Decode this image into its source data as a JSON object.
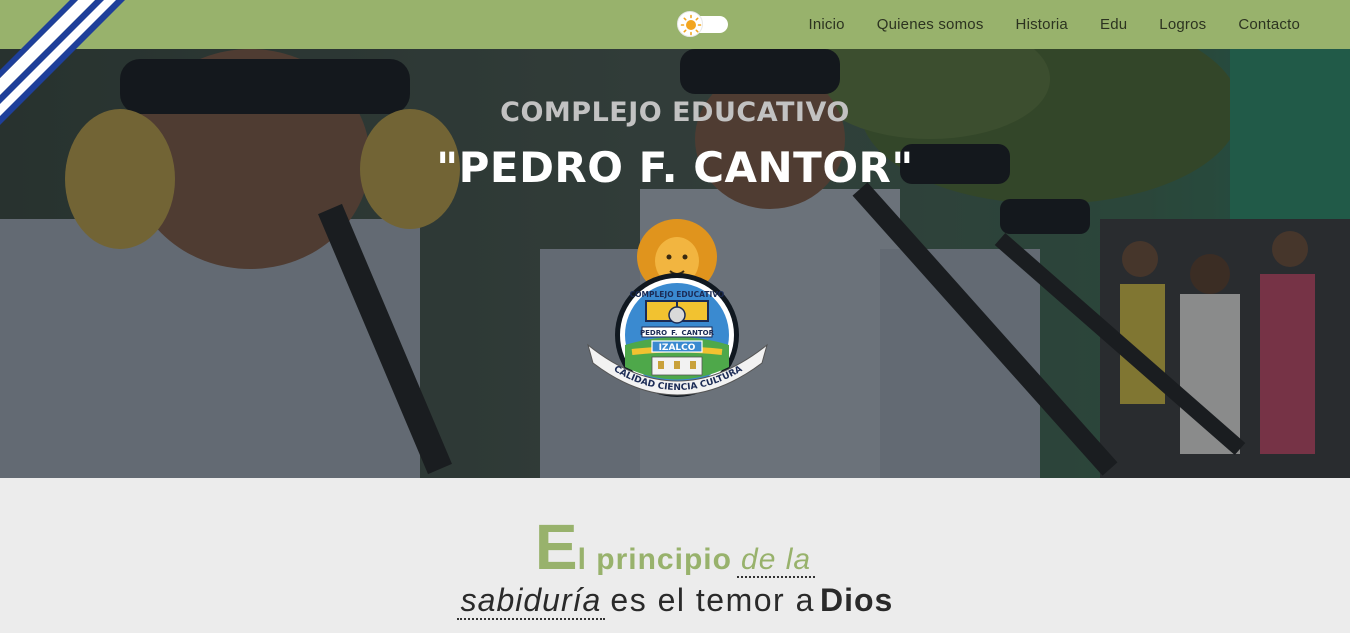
{
  "nav": {
    "links": [
      "Inicio",
      "Quienes somos",
      "Historia",
      "Edu",
      "Logros",
      "Contacto"
    ]
  },
  "theme_toggle": {
    "icon": "sun-icon",
    "state": "light"
  },
  "hero": {
    "subtitle": "COMPLEJO EDUCATIVO",
    "title": "\"PEDRO F. CANTOR\"",
    "crest": {
      "top_text": "COMPLEJO EDUCATIVO",
      "name_left": "PEDRO",
      "name_mid": "F.",
      "name_right": "CANTOR",
      "city": "IZALCO",
      "motto": "CALIDAD CIENCIA CULTURA"
    }
  },
  "motto": {
    "big_letter": "E",
    "part1": "l principio",
    "part2": "de la",
    "part3": "sabiduría",
    "part4": "es el temor a",
    "part5": "Dios"
  },
  "colors": {
    "accent_green": "#98b26c",
    "ribbon_blue": "#1e3f9a",
    "text_dark": "#2a2a2a"
  }
}
